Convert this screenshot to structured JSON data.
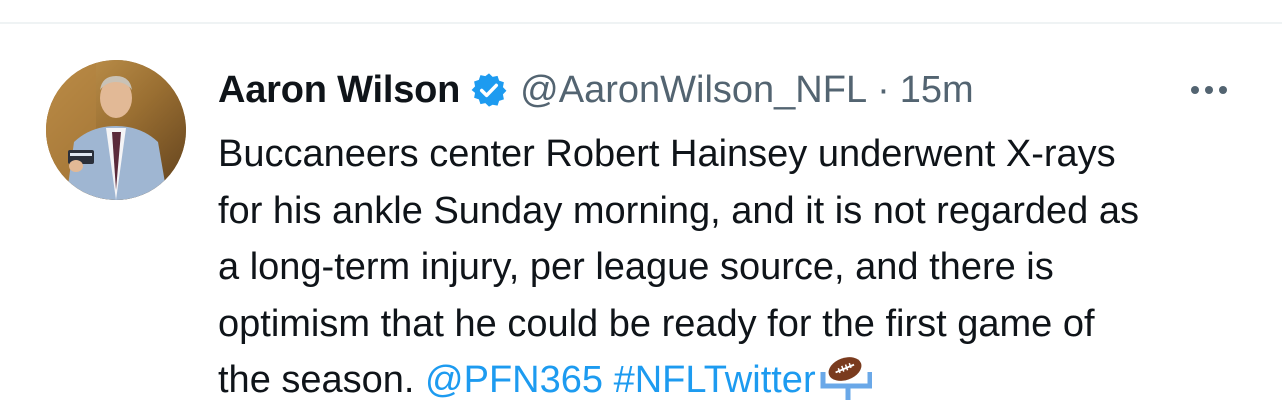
{
  "tweet": {
    "author_name": "Aaron Wilson",
    "handle": "@AaronWilson_NFL",
    "separator": "·",
    "time": "15m",
    "text": "Buccaneers center Robert Hainsey underwent X-rays\nfor his ankle Sunday morning, and it is not regarded as\na long-term injury, per league source, and there is\noptimism that he could be ready for the first game of\nthe season. ",
    "mention": "@PFN365",
    "hashtag": "#NFLTwitter",
    "hashflag_icon": "football-goalpost-icon",
    "verified_icon": "verified-badge-icon",
    "more_icon": "more-options-icon"
  },
  "colors": {
    "link": "#1d9bf0",
    "secondary_text": "#536471",
    "verified": "#1d9bf0"
  }
}
